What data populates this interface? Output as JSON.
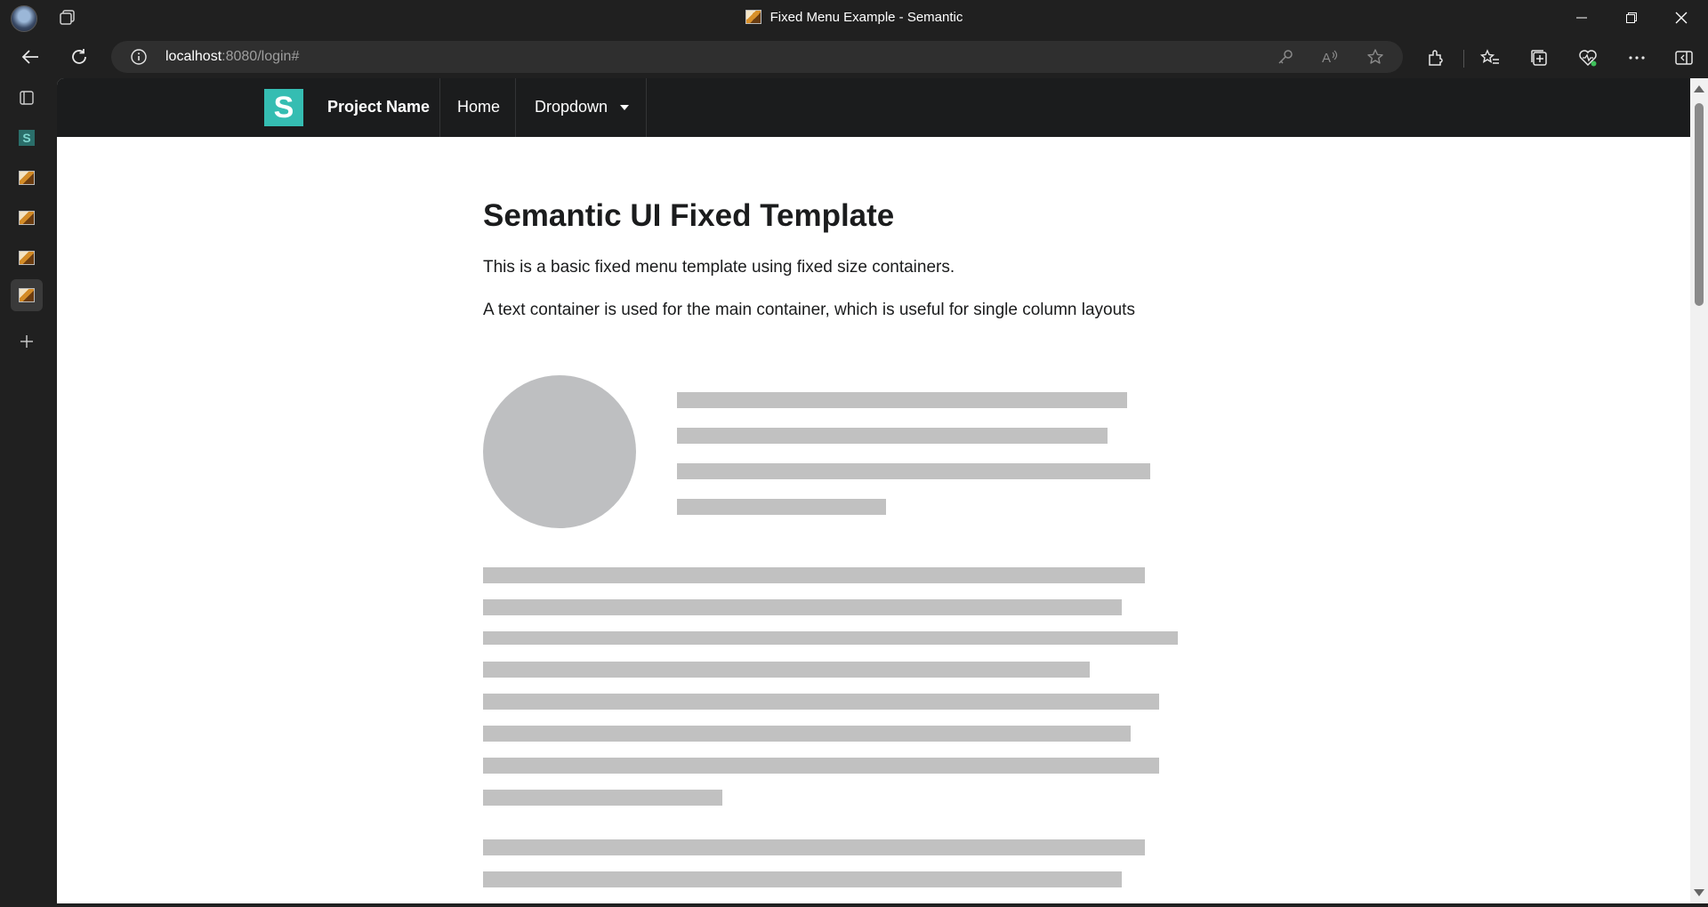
{
  "window": {
    "title": "Fixed Menu Example - Semantic"
  },
  "addressbar": {
    "url_host": "localhost",
    "url_rest": ":8080/login#"
  },
  "page": {
    "menu": {
      "logo_letter": "S",
      "brand": "Project Name",
      "home": "Home",
      "dropdown": "Dropdown"
    },
    "heading": "Semantic UI Fixed Template",
    "para1": "This is a basic fixed menu template using fixed size containers.",
    "para2": "A text container is used for the main container, which is useful for single column layouts"
  },
  "colors": {
    "menu_bg": "#1b1c1d",
    "logo_teal": "#35bdb2",
    "placeholder_gray": "#c1c1c1"
  }
}
